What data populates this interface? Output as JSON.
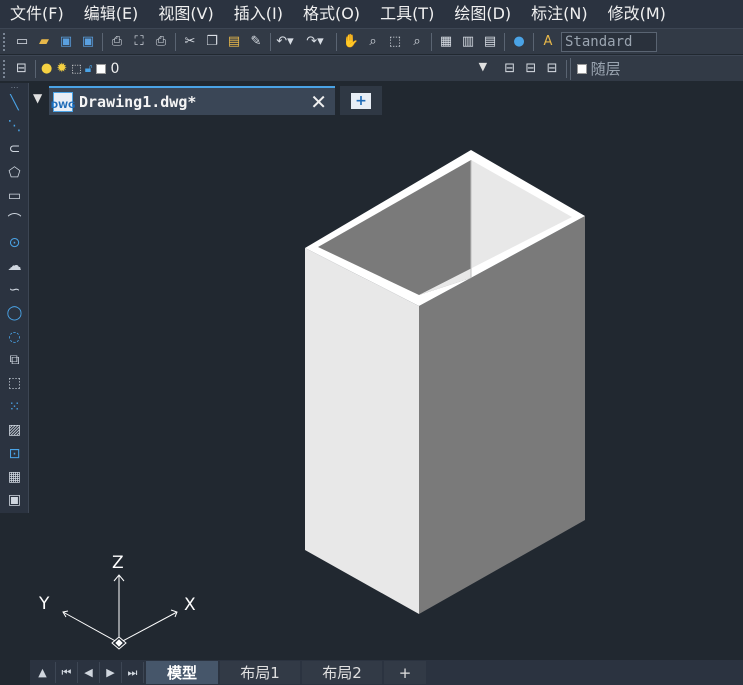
{
  "menu": [
    "文件(F)",
    "编辑(E)",
    "视图(V)",
    "插入(I)",
    "格式(O)",
    "工具(T)",
    "绘图(D)",
    "标注(N)",
    "修改(M)"
  ],
  "toolbar": {
    "text_style": "Standard",
    "icons": [
      "new-icon",
      "open-icon",
      "save-icon",
      "saveas-icon",
      "print-icon",
      "preview-icon",
      "plot-icon",
      "cut-icon",
      "copy-icon",
      "paste-icon",
      "matchprop-icon",
      "undo-icon",
      "redo-icon",
      "pan-icon",
      "zoom-realtime-icon",
      "zoom-window-icon",
      "zoom-previous-icon",
      "properties-icon",
      "designcenter-icon",
      "toolpalette-icon",
      "help-icon",
      "textstyle-icon"
    ]
  },
  "layer_bar": {
    "current_layer": "0",
    "linetype_label": "随层"
  },
  "left_tools": [
    "line-icon",
    "xline-icon",
    "polyline-icon",
    "polygon-icon",
    "rectangle-icon",
    "arc-icon",
    "circle-icon",
    "revcloud-icon",
    "spline-icon",
    "ellipse-icon",
    "ellipse-arc-icon",
    "insert-block-icon",
    "make-block-icon",
    "point-icon",
    "hatch-icon",
    "region-icon",
    "table-icon",
    "mtext-icon"
  ],
  "document_tab": {
    "title": "Drawing1.dwg*",
    "icon_text": "DWG"
  },
  "ucs": {
    "x_label": "X",
    "y_label": "Y",
    "z_label": "Z"
  },
  "layout_tabs": {
    "model": "模型",
    "layout1": "布局1",
    "layout2": "布局2",
    "add": "+"
  },
  "colors": {
    "background": "#212830",
    "accent": "#4aa3e6",
    "box_light": "#e8e8e8",
    "box_dark": "#7a7a7a",
    "rim": "#ffffff"
  }
}
